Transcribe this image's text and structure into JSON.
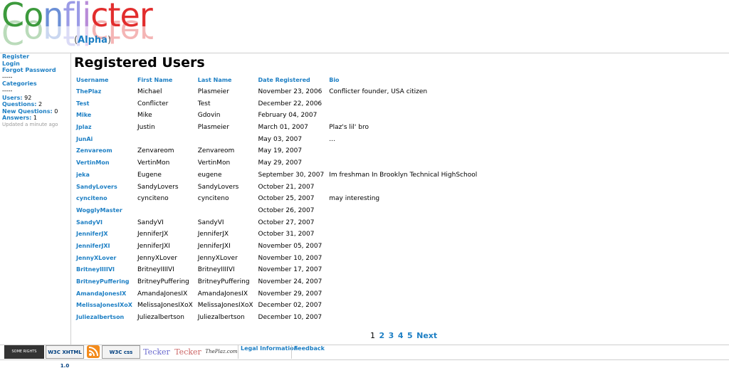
{
  "header": {
    "logo_text": "Conflicter",
    "logo_letters": [
      "Co",
      "n",
      "fl",
      "i",
      "cter"
    ],
    "alpha_open": "(",
    "alpha_label": "Alpha",
    "alpha_close": ")"
  },
  "sidebar": {
    "links": [
      "Register",
      "Login",
      "Forgot Password"
    ],
    "sep1": "-----",
    "categories_label": "Categories",
    "sep2": "-----",
    "stats": [
      {
        "label": "Users:",
        "value": "92"
      },
      {
        "label": "Questions:",
        "value": "2"
      },
      {
        "label": "New Questions:",
        "value": "0"
      },
      {
        "label": "Answers:",
        "value": "1"
      }
    ],
    "updated": "Updated a minute ago"
  },
  "main": {
    "title": "Registered Users",
    "columns": [
      "Username",
      "First Name",
      "Last Name",
      "Date Registered",
      "Bio"
    ],
    "rows": [
      [
        "ThePlaz",
        "Michael",
        "Plasmeier",
        "November 23, 2006",
        "Conflicter founder, USA citizen"
      ],
      [
        "Test",
        "Conflicter",
        "Test",
        "December 22, 2006",
        ""
      ],
      [
        "Mike",
        "Mike",
        "Gdovin",
        "February 04, 2007",
        ""
      ],
      [
        "Jplaz",
        "Justin",
        "Plasmeier",
        "March 01, 2007",
        "Plaz's lil' bro"
      ],
      [
        "JunAi",
        "",
        "",
        "May 03, 2007",
        "..."
      ],
      [
        "Zenvareom",
        "Zenvareom",
        "Zenvareom",
        "May 19, 2007",
        ""
      ],
      [
        "VertinMon",
        "VertinMon",
        "VertinMon",
        "May 29, 2007",
        ""
      ],
      [
        "jeka",
        "Eugene",
        "eugene",
        "September 30, 2007",
        "Im freshman In Brooklyn Technical HighSchool"
      ],
      [
        "SandyLovers",
        "SandyLovers",
        "SandyLovers",
        "October 21, 2007",
        ""
      ],
      [
        "cynciteno",
        "cynciteno",
        "cynciteno",
        "October 25, 2007",
        "may interesting"
      ],
      [
        "WogglyMaster",
        "",
        "",
        "October 26, 2007",
        ""
      ],
      [
        "SandyVI",
        "SandyVI",
        "SandyVI",
        "October 27, 2007",
        ""
      ],
      [
        "JenniferJX",
        "JenniferJX",
        "JenniferJX",
        "October 31, 2007",
        ""
      ],
      [
        "JenniferJXI",
        "JenniferJXI",
        "JenniferJXI",
        "November 05, 2007",
        ""
      ],
      [
        "JennyXLover",
        "JennyXLover",
        "JennyXLover",
        "November 10, 2007",
        ""
      ],
      [
        "BritneyIIIIVI",
        "BritneyIIIIVI",
        "BritneyIIIIVI",
        "November 17, 2007",
        ""
      ],
      [
        "BritneyPuffering",
        "BritneyPuffering",
        "BritneyPuffering",
        "November 24, 2007",
        ""
      ],
      [
        "AmandaJonesIX",
        "AmandaJonesIX",
        "AmandaJonesIX",
        "November 29, 2007",
        ""
      ],
      [
        "MelissaJonesIXoX",
        "MelissaJonesIXoX",
        "MelissaJonesIXoX",
        "December 02, 2007",
        ""
      ],
      [
        "Juliezalbertson",
        "Juliezalbertson",
        "Juliezalbertson",
        "December 10, 2007",
        ""
      ]
    ],
    "pager": {
      "current": "1",
      "pages": [
        "2",
        "3",
        "4",
        "5"
      ],
      "next": "Next"
    }
  },
  "footer": {
    "badges": [
      {
        "text": "SOME RIGHTS RESERVED",
        "icon": "creative-commons-badge"
      },
      {
        "text": "W3C XHTML 1.0",
        "icon": "w3c-xhtml-badge"
      },
      {
        "text": "",
        "icon": "rss-icon"
      },
      {
        "text": "W3C css",
        "icon": "w3c-css-badge"
      },
      {
        "text": "Tecker",
        "icon": "tecker-badge"
      },
      {
        "text": "Tecker",
        "icon": "tecker-alt-badge"
      },
      {
        "text": "ThePlaz.com",
        "icon": "theplaz-badge"
      }
    ],
    "links": [
      "Legal Information",
      "Feedback"
    ]
  }
}
